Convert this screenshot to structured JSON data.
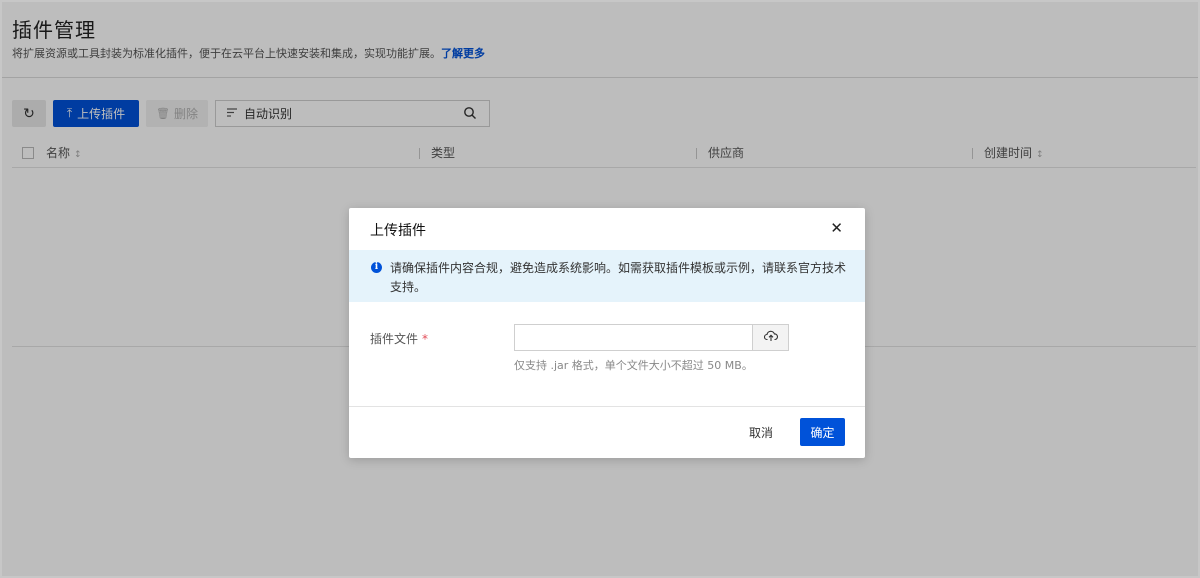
{
  "page": {
    "title": "插件管理",
    "subtitle": "将扩展资源或工具封装为标准化插件，便于在云平台上快速安装和集成，实现功能扩展。",
    "learn_more": "了解更多"
  },
  "toolbar": {
    "refresh_icon": "refresh-icon",
    "upload_label": "上传插件",
    "delete_label": "删除",
    "filter_text": "自动识别"
  },
  "table": {
    "columns": [
      "名称",
      "类型",
      "供应商",
      "创建时间"
    ]
  },
  "modal": {
    "title": "上传插件",
    "notice": "请确保插件内容合规，避免造成系统影响。如需获取插件模板或示例，请联系官方技术支持。",
    "field_label": "插件文件",
    "required_mark": "*",
    "file_value": "",
    "hint": "仅支持 .jar 格式，单个文件大小不超过 50 MB。",
    "cancel_label": "取消",
    "confirm_label": "确定"
  },
  "colors": {
    "primary": "#0052d9",
    "notice_bg": "#e5f3fb",
    "required": "#e34d59"
  }
}
